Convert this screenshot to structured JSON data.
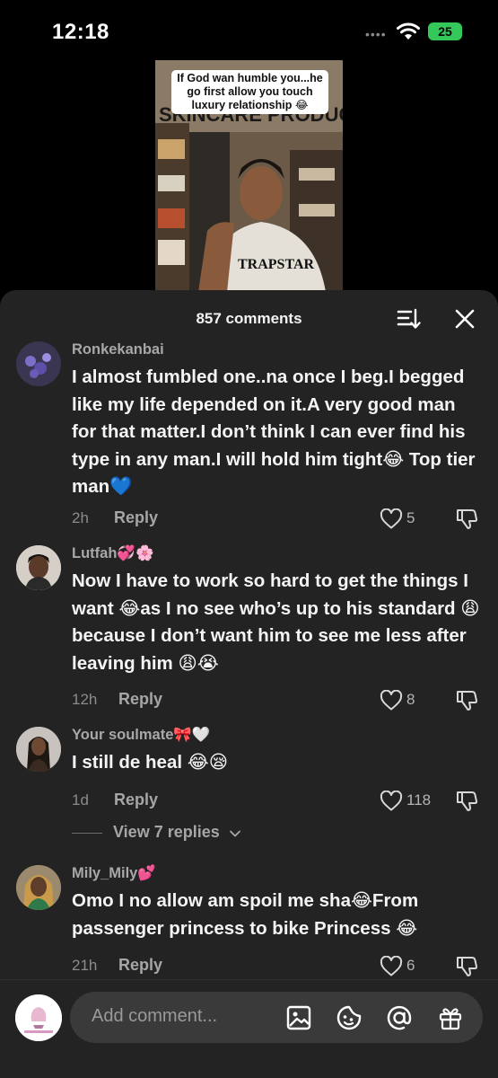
{
  "status_bar": {
    "time": "12:18",
    "dots": "••••",
    "battery": "25"
  },
  "video": {
    "caption": "If God wan humble you...he go first allow you touch luxury relationship 😂",
    "sign_text": "SKINCARE PRODUC",
    "shirt_text": "TRAPSTAR"
  },
  "comments_header": {
    "count_label": "857 comments"
  },
  "comments": [
    {
      "username": "Ronkekanbai",
      "text": "I almost fumbled one..na once I beg.I begged like my life depended on it.A very good man for that matter.I don’t think I can ever find his type in any man.I will hold him tight😂 Top tier man💙",
      "time": "2h",
      "reply": "Reply",
      "likes": "5"
    },
    {
      "username": "Lutfah💞🌸",
      "text": "Now I have to work so hard to get the things I want 😂as I no see who’s up to his standard 😩 because I don’t want him to see me less after leaving him 😩😭",
      "time": "12h",
      "reply": "Reply",
      "likes": "8"
    },
    {
      "username": "Your soulmate🎀🤍",
      "text": "I still de heal 😂😪",
      "time": "1d",
      "reply": "Reply",
      "likes": "118"
    },
    {
      "username": "Mily_Mily💕",
      "text": "Omo I no allow am spoil me sha😂From passenger princess to bike Princess 😂",
      "time": "21h",
      "reply": "Reply",
      "likes": "6"
    }
  ],
  "view_replies": "View 7 replies",
  "input": {
    "placeholder": "Add comment...",
    "icons": [
      "image-icon",
      "sticker-icon",
      "mention-icon",
      "gift-icon"
    ]
  },
  "colors": {
    "sheet_bg": "#232323",
    "battery": "#34c759",
    "heart_blue": "#2f80ed"
  }
}
